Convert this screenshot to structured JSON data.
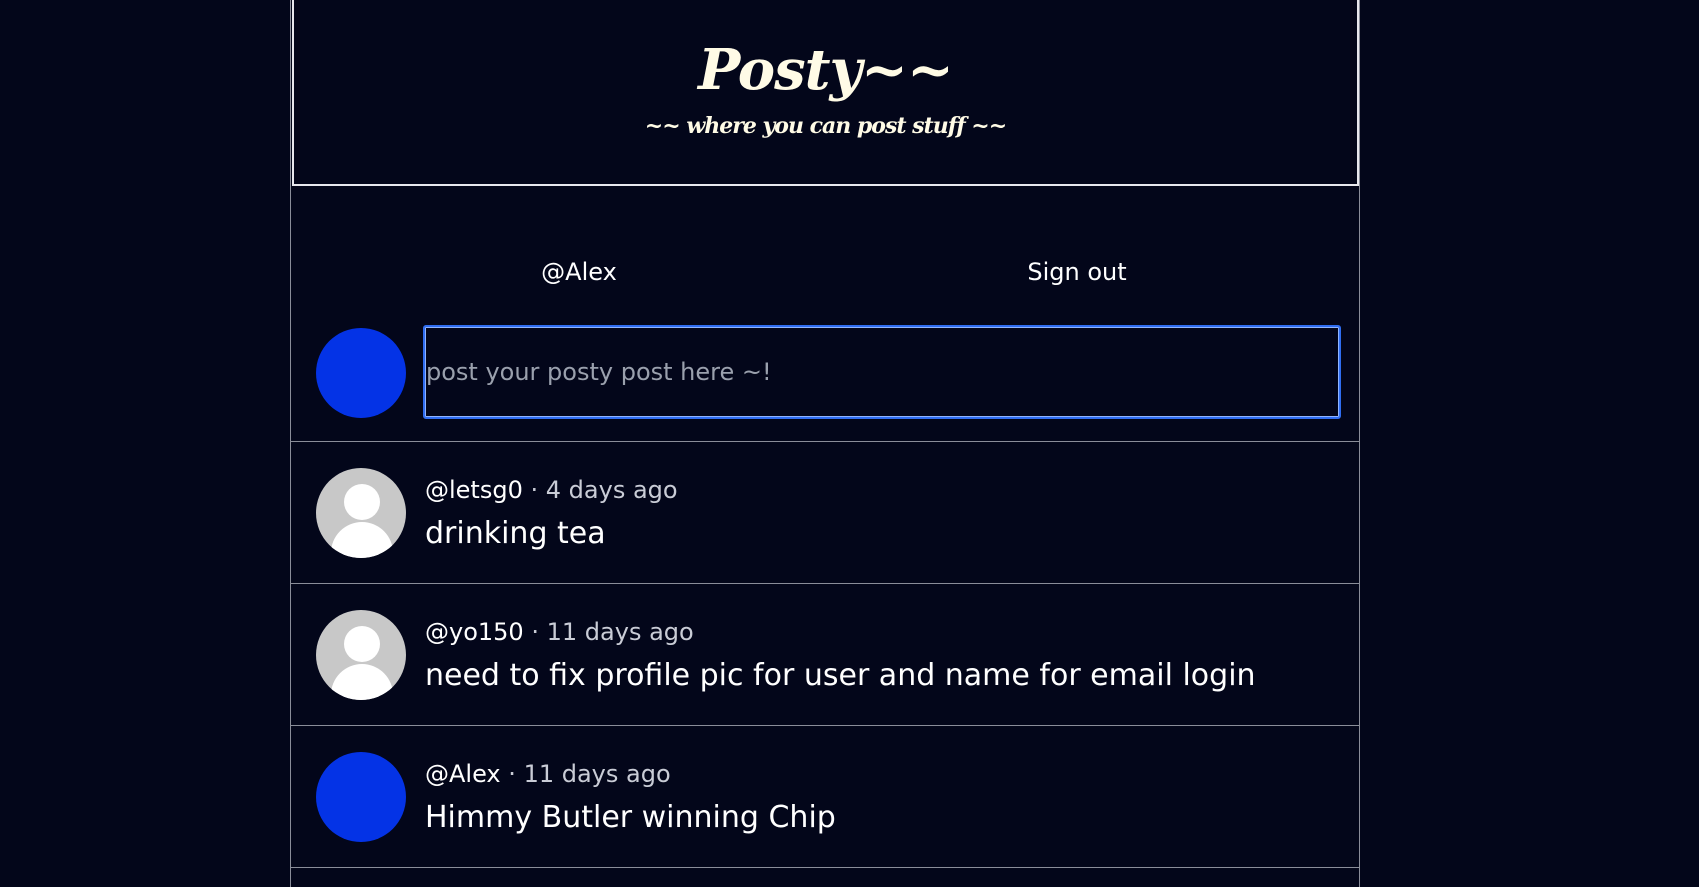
{
  "header": {
    "title": "Posty~~",
    "tagline": "~~ where you can post stuff ~~"
  },
  "nav": {
    "user_handle": "@Alex",
    "signout_label": "Sign out"
  },
  "composer": {
    "placeholder": "post your posty post here ~!",
    "avatar_color": "#0433e6"
  },
  "posts": [
    {
      "handle": "@letsg0",
      "separator": "·",
      "time": "4 days ago",
      "text": "drinking tea",
      "avatar": "default-user-icon"
    },
    {
      "handle": "@yo150",
      "separator": "·",
      "time": "11 days ago",
      "text": "need to fix profile pic for user and name for email login",
      "avatar": "default-user-icon"
    },
    {
      "handle": "@Alex",
      "separator": "·",
      "time": "11 days ago",
      "text": "Himmy Butler winning Chip",
      "avatar_color": "#0433e6"
    }
  ],
  "colors": {
    "background": "#03061a",
    "accent": "#0433e6",
    "input_border": "#2f6df2",
    "title": "#fffbe6"
  }
}
